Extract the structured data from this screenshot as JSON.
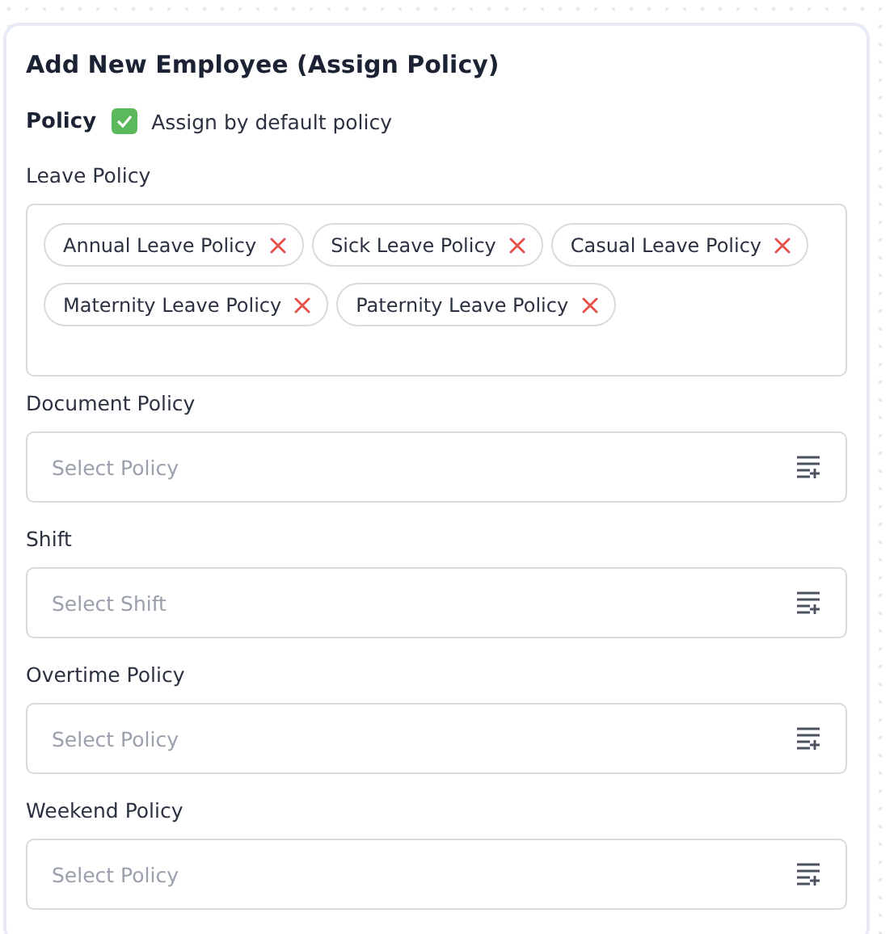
{
  "title": "Add New Employee (Assign Policy)",
  "policy": {
    "label": "Policy",
    "checked": true,
    "checkbox_label": "Assign by default policy"
  },
  "leave_policy": {
    "label": "Leave Policy",
    "tags": [
      {
        "label": "Annual Leave Policy"
      },
      {
        "label": "Sick Leave Policy"
      },
      {
        "label": "Casual Leave Policy"
      },
      {
        "label": "Maternity Leave Policy"
      },
      {
        "label": "Paternity Leave Policy"
      }
    ]
  },
  "selects": [
    {
      "label": "Document Policy",
      "placeholder": "Select Policy"
    },
    {
      "label": "Shift",
      "placeholder": "Select Shift"
    },
    {
      "label": "Overtime Policy",
      "placeholder": "Select Policy"
    },
    {
      "label": "Weekend Policy",
      "placeholder": "Select Policy"
    }
  ]
}
